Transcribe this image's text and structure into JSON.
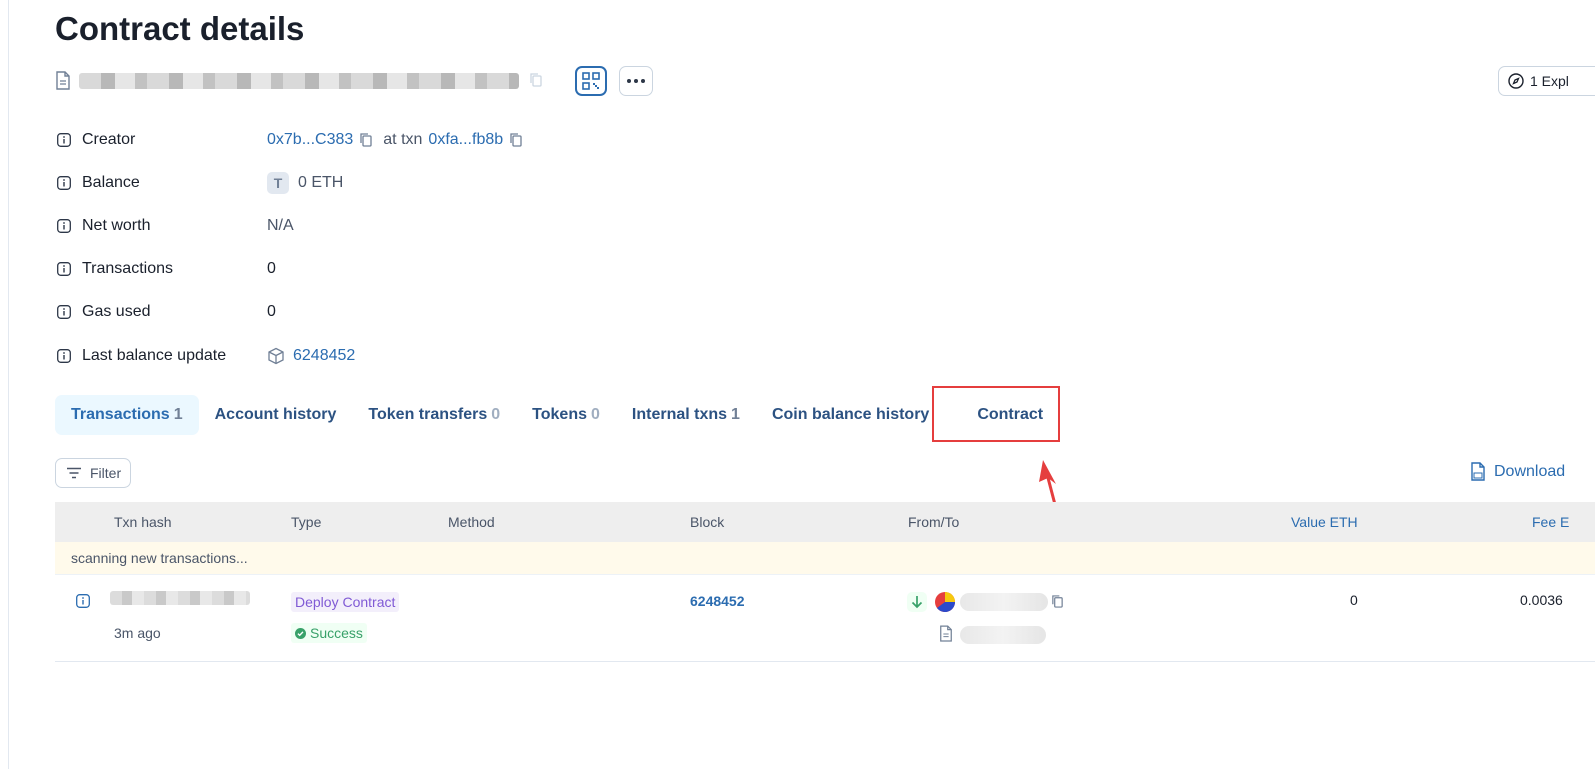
{
  "page": {
    "title": "Contract details",
    "explorer_label": "1 Expl"
  },
  "details": {
    "creator_label": "Creator",
    "creator_address": "0x7b...C383",
    "at_txn_text": "at txn",
    "creator_txn": "0xfa...fb8b",
    "balance_label": "Balance",
    "balance_token_letter": "T",
    "balance_value": "0 ETH",
    "net_worth_label": "Net worth",
    "net_worth_value": "N/A",
    "transactions_label": "Transactions",
    "transactions_value": "0",
    "gas_used_label": "Gas used",
    "gas_used_value": "0",
    "last_balance_update_label": "Last balance update",
    "last_balance_update_block": "6248452"
  },
  "tabs": [
    {
      "label": "Transactions",
      "count": "1"
    },
    {
      "label": "Account history",
      "count": ""
    },
    {
      "label": "Token transfers",
      "count": "0"
    },
    {
      "label": "Tokens",
      "count": "0"
    },
    {
      "label": "Internal txns",
      "count": "1"
    },
    {
      "label": "Coin balance history",
      "count": ""
    },
    {
      "label": "Contract",
      "count": ""
    }
  ],
  "toolbar": {
    "filter_label": "Filter",
    "download_label": "Download"
  },
  "table": {
    "headers": {
      "txn_hash": "Txn hash",
      "type": "Type",
      "method": "Method",
      "block": "Block",
      "from_to": "From/To",
      "value": "Value ETH",
      "fee": "Fee E"
    },
    "scanning_text": "scanning new transactions...",
    "rows": [
      {
        "age": "3m ago",
        "type": "Deploy Contract",
        "status": "Success",
        "block": "6248452",
        "value": "0",
        "fee": "0.0036"
      }
    ]
  },
  "colors": {
    "link": "#2b6cb0",
    "highlight": "#e53e3e",
    "success": "#38a169",
    "type_badge": "#805ad5"
  }
}
